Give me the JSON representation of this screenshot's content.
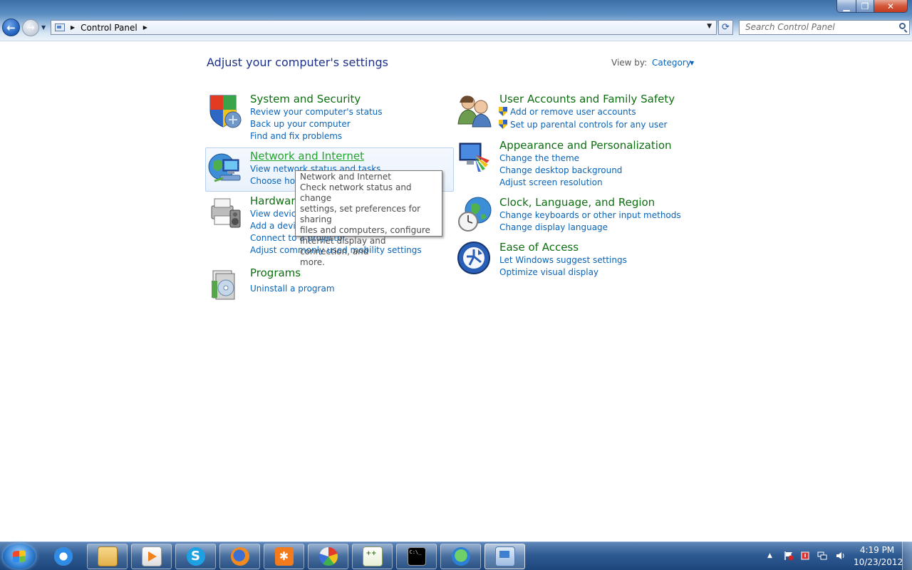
{
  "window": {
    "minimize_symbol": "▁",
    "maximize_symbol": "❐",
    "close_symbol": "✕"
  },
  "address_bar": {
    "path_item": "Control Panel",
    "search_placeholder": "Search Control Panel"
  },
  "main": {
    "title": "Adjust your computer's settings",
    "view_by_label": "View by:",
    "view_by_value": "Category"
  },
  "categories": {
    "system_security": {
      "title": "System and Security",
      "links": [
        "Review your computer's status",
        "Back up your computer",
        "Find and fix problems"
      ]
    },
    "network_internet": {
      "title": "Network and Internet",
      "links": [
        "View network status and tasks",
        "Choose homegroup and sharing options"
      ]
    },
    "hardware_sound": {
      "title": "Hardware and Sound",
      "links": [
        "View devices and printers",
        "Add a device",
        "Connect to a projector",
        "Adjust commonly used mobility settings"
      ]
    },
    "programs": {
      "title": "Programs",
      "links": [
        "Uninstall a program"
      ]
    },
    "user_accounts": {
      "title": "User Accounts and Family Safety",
      "links": [
        "Add or remove user accounts",
        "Set up parental controls for any user"
      ]
    },
    "appearance": {
      "title": "Appearance and Personalization",
      "links": [
        "Change the theme",
        "Change desktop background",
        "Adjust screen resolution"
      ]
    },
    "clock_language": {
      "title": "Clock, Language, and Region",
      "links": [
        "Change keyboards or other input methods",
        "Change display language"
      ]
    },
    "ease_of_access": {
      "title": "Ease of Access",
      "links": [
        "Let Windows suggest settings",
        "Optimize visual display"
      ]
    }
  },
  "tooltip": {
    "title": "Network and Internet",
    "lines": [
      "Check network status and change",
      "settings, set preferences for sharing",
      "files and computers, configure",
      "Internet display and connection, and",
      "more."
    ]
  },
  "taskbar": {
    "apps": [
      "internet-explorer",
      "windows-explorer",
      "media-player",
      "skype",
      "firefox",
      "xampp",
      "paint",
      "notepad-plus-plus",
      "command-prompt",
      "network-tool",
      "control-panel"
    ],
    "cmd_label": "C:\\_",
    "clock_time": "4:19 PM",
    "clock_date": "10/23/2012"
  }
}
